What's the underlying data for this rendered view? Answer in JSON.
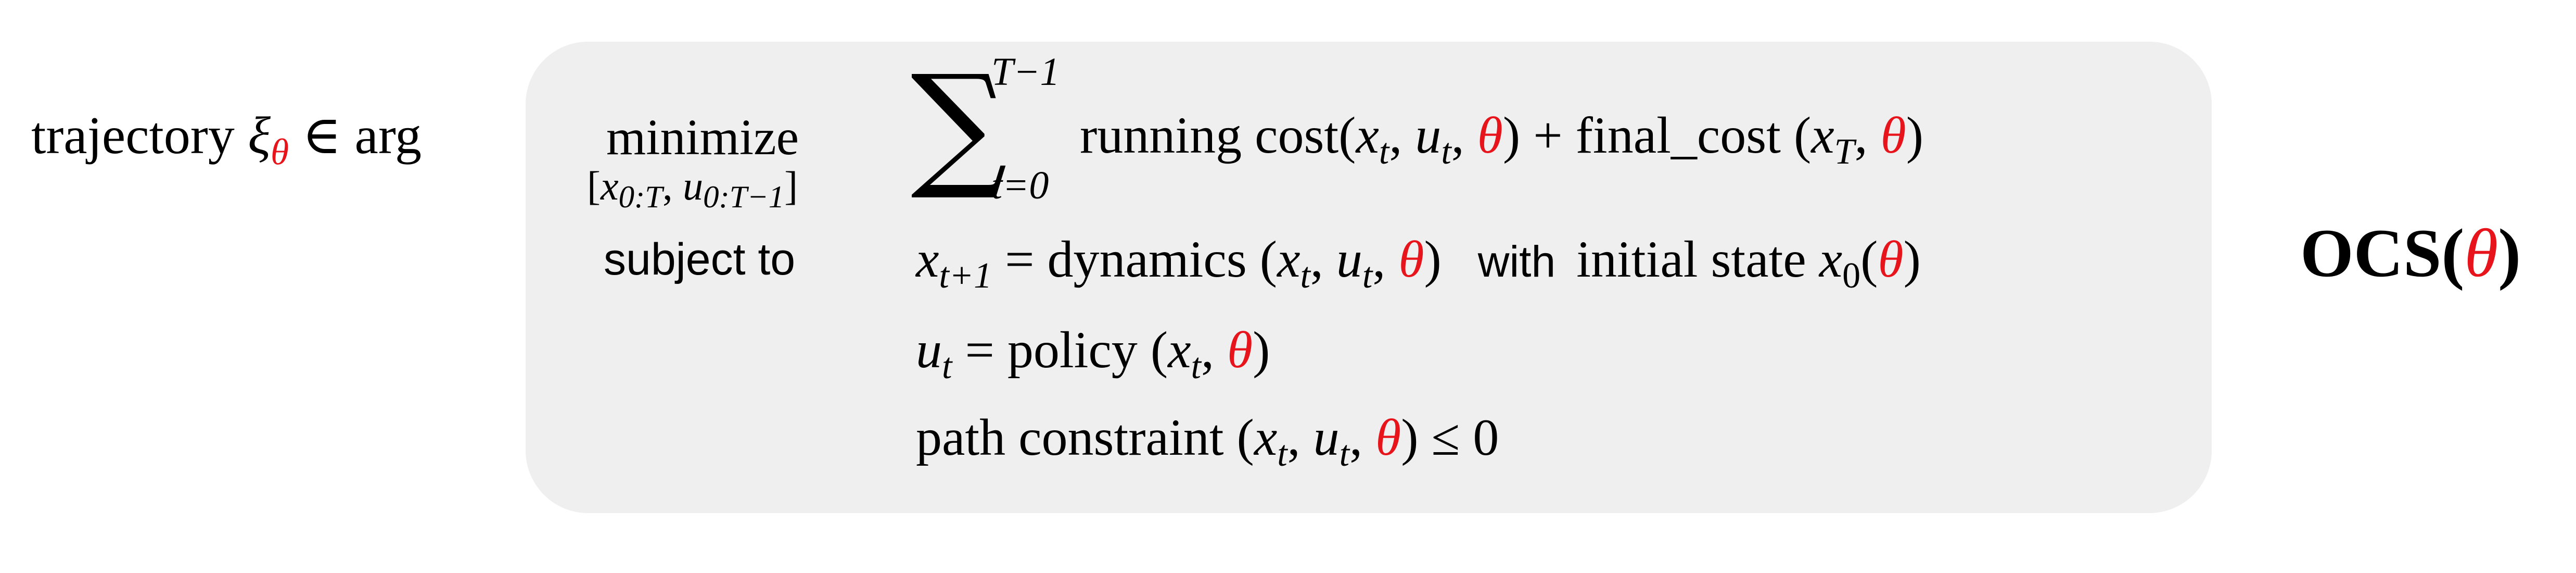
{
  "lhs": {
    "prefix": "trajectory ",
    "xi": "ξ",
    "theta": "θ",
    "suffix": " ∈ arg"
  },
  "problem": {
    "minimize": "minimize",
    "minimize_vars": "[x0:T, u0:T−1]",
    "subject_to": "subject to",
    "sum_symbol": "∑",
    "sum_upper": "T−1",
    "sum_lower": "t=0",
    "running_cost": "running cost",
    "final_cost": "final_cost",
    "dynamics": "dynamics",
    "with": "with",
    "initial_state": "initial state",
    "policy": "policy",
    "path_constraint": "path constraint"
  },
  "label": {
    "ocs": "OCS",
    "theta": "θ"
  },
  "colors": {
    "theta": "#e8141b",
    "panel": "#efefef"
  }
}
